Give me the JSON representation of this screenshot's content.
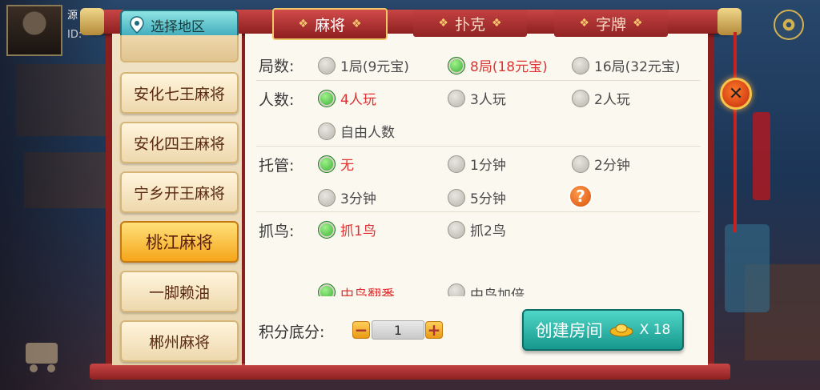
{
  "user": {
    "name_partial": "源",
    "id_label": "ID:"
  },
  "region_tab": {
    "label": "选择地区",
    "icon": "location-pin-icon"
  },
  "game_tabs": [
    {
      "label": "麻将",
      "active": true
    },
    {
      "label": "扑克",
      "active": false
    },
    {
      "label": "字牌",
      "active": false
    }
  ],
  "game_list": [
    {
      "label": "安化七王麻将",
      "selected": false
    },
    {
      "label": "安化四王麻将",
      "selected": false
    },
    {
      "label": "宁乡开王麻将",
      "selected": false
    },
    {
      "label": "桃江麻将",
      "selected": true
    },
    {
      "label": "一脚赖油",
      "selected": false
    },
    {
      "label": "郴州麻将",
      "selected": false
    }
  ],
  "rules": {
    "rounds": {
      "label": "局数:",
      "options": [
        {
          "label": "1局(9元宝)",
          "checked": false
        },
        {
          "label": "8局(18元宝)",
          "checked": true
        },
        {
          "label": "16局(32元宝)",
          "checked": false
        }
      ]
    },
    "players": {
      "label": "人数:",
      "options": [
        {
          "label": "4人玩",
          "checked": true
        },
        {
          "label": "3人玩",
          "checked": false
        },
        {
          "label": "2人玩",
          "checked": false
        },
        {
          "label": "自由人数",
          "checked": false
        }
      ]
    },
    "autoplay": {
      "label": "托管:",
      "options": [
        {
          "label": "无",
          "checked": true
        },
        {
          "label": "1分钟",
          "checked": false
        },
        {
          "label": "2分钟",
          "checked": false
        },
        {
          "label": "3分钟",
          "checked": false
        },
        {
          "label": "5分钟",
          "checked": false
        }
      ]
    },
    "catch_bird": {
      "label": "抓鸟:",
      "options": [
        {
          "label": "抓1鸟",
          "checked": true
        },
        {
          "label": "抓2鸟",
          "checked": false
        }
      ]
    },
    "bird_extra": {
      "options": [
        {
          "label": "中鸟翻番",
          "checked": true
        },
        {
          "label": "中鸟加倍",
          "checked": false
        }
      ]
    }
  },
  "score_base": {
    "label": "积分底分:",
    "value": "1",
    "minus": "−",
    "plus": "+"
  },
  "create_button": {
    "label": "创建房间",
    "cost": "X 18",
    "icon": "gold-ingot-icon"
  },
  "close_button": {
    "symbol": "✕"
  },
  "help_icon": {
    "symbol": "?"
  },
  "colors": {
    "selected_text": "#dd3333",
    "radio_on": "#2da52a",
    "create_button": "#17988e",
    "tab_red": "#c34040"
  }
}
